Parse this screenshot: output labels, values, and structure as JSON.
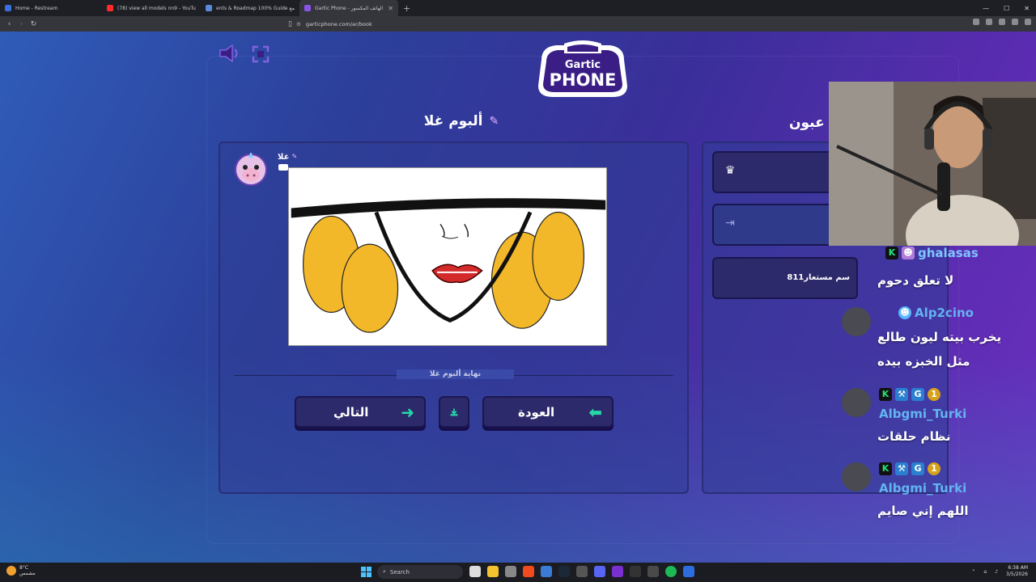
{
  "browser": {
    "tabs": [
      {
        "title": "Home - Restream",
        "color": "#3b6fe0",
        "active": false
      },
      {
        "title": "(78) view all models nn9 - YouTube",
        "color": "#ff2a2a",
        "active": false
      },
      {
        "title": "ents & Roadmap 100% Guide مجتمع",
        "color": "#5b8bd8",
        "active": false
      },
      {
        "title": "Gartic Phone - لعبة الهاتف المكسور",
        "color": "#8b54e8",
        "active": true
      }
    ],
    "url": "garticphone.com/ar/book"
  },
  "game": {
    "logo_top": "Gartic",
    "logo_bottom": "PHONE",
    "album_title": "ألبوم غلا",
    "author_name": "غلا",
    "end_label": "نهاية ألبوم غلا",
    "buttons": {
      "next": "التالي",
      "back": "العودة"
    },
    "players_title": "عبون",
    "player3_name": "سم مستعار811"
  },
  "chat": [
    {
      "user": "ghalasas",
      "text": "لا تعلق دحوم"
    },
    {
      "user": "Alp2cino",
      "text": "يخرب بيته ليون طالع"
    },
    {
      "user": "",
      "text": "مثل الخبزه بيده"
    },
    {
      "user": "Albgmi_Turki",
      "text": "نظام حلقات"
    },
    {
      "user": "Albgmi_Turki",
      "text": "اللهم إني صايم"
    }
  ],
  "taskbar": {
    "weather_temp": "8°C",
    "weather_desc": "مشمس",
    "search": "Search",
    "time": "6:38 AM",
    "date": "3/5/2026"
  },
  "colors": {
    "accent_green": "#27d7a8",
    "chat_user": "#63b3f0",
    "panel": "#2c2a6a"
  }
}
